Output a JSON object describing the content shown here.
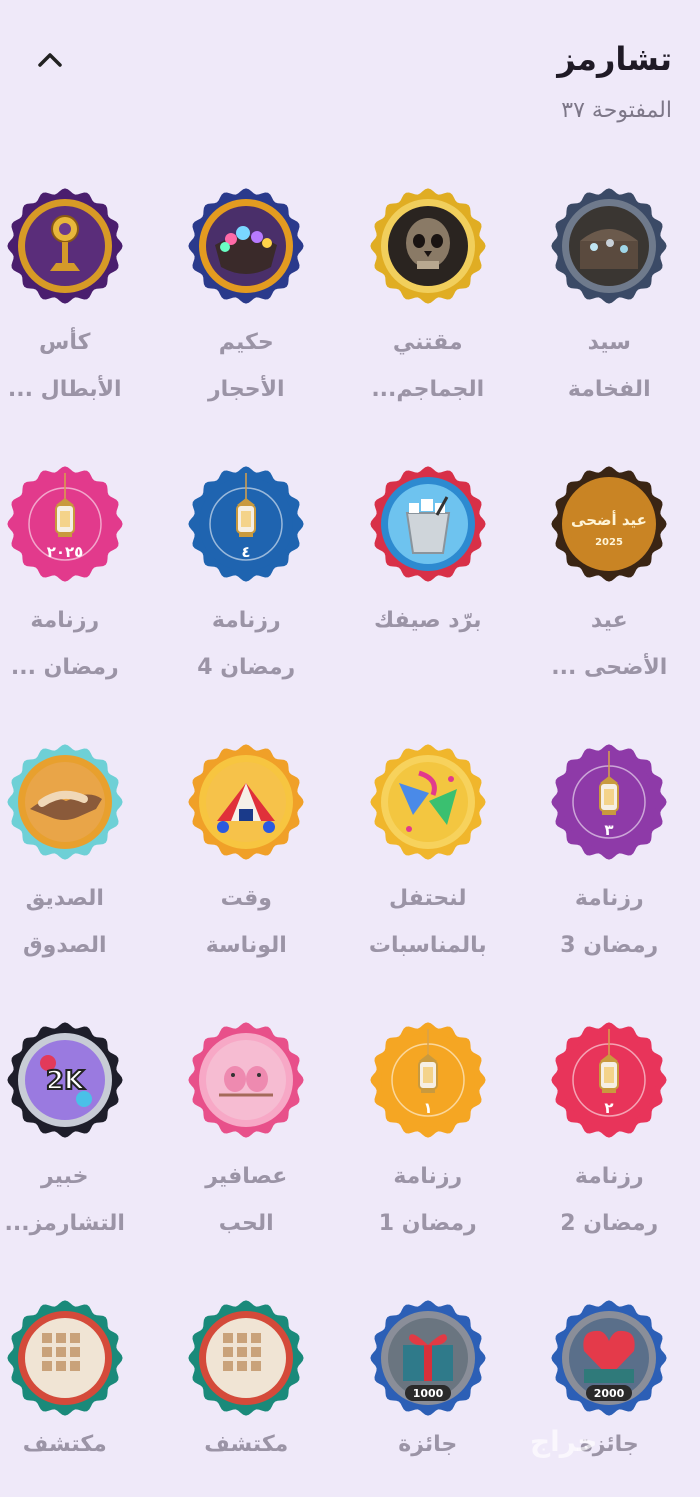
{
  "header": {
    "title": "تشارمز",
    "subtitle": "المفتوحة ٣٧"
  },
  "colors": {
    "background": "#efe9f9",
    "label": "#9b94a6",
    "title": "#1f1a26"
  },
  "badges": [
    {
      "line1": "سيد",
      "line2": "الفخامة",
      "rim": "#3b4a66",
      "inner": "#6f7a8c",
      "art": "treasure-chest-icon",
      "fill": "#3a3430"
    },
    {
      "line1": "مقتني",
      "line2": "الجماجم...",
      "rim": "#e0ad23",
      "inner": "#f1cf5c",
      "art": "skull-icon",
      "fill": "#2a2624"
    },
    {
      "line1": "حكيم",
      "line2": "الأحجار",
      "rim": "#2a3a8c",
      "inner": "#e39b20",
      "art": "gem-pot-icon",
      "fill": "#5a3b7a"
    },
    {
      "line1": "كأس",
      "line2": "الأبطال ...",
      "rim": "#4a1e6e",
      "inner": "#d79a26",
      "art": "trophy-icon",
      "fill": "#6a3a8c"
    },
    {
      "line1": "عيد",
      "line2": "الأضحى ...",
      "rim": "#3a2514",
      "inner": "#c98424",
      "art": "eid-text-icon",
      "fill": "#b87a22"
    },
    {
      "line1": "برّد صيفك",
      "line2": "",
      "rim": "#d83048",
      "inner": "#2d8ad0",
      "art": "ice-bucket-icon",
      "fill": "#5eb4e8"
    },
    {
      "line1": "رزنامة",
      "line2": "رمضان 4",
      "rim": "#1f64b0",
      "inner": "#1f64b0",
      "art": "lantern-icon",
      "fill": "#1f64b0",
      "num": "٤"
    },
    {
      "line1": "رزنامة",
      "line2": "رمضان ...",
      "rim": "#e23a8c",
      "inner": "#e23a8c",
      "art": "lantern-icon",
      "fill": "#e23a8c",
      "num": "٢٠٢٥"
    },
    {
      "line1": "رزنامة",
      "line2": "رمضان 3",
      "rim": "#8e3aa8",
      "inner": "#8e3aa8",
      "art": "lantern-icon",
      "fill": "#8e3aa8",
      "num": "٣"
    },
    {
      "line1": "لنحتفل",
      "line2": "بالمناسبات",
      "rim": "#f0b62c",
      "inner": "#f7d25c",
      "art": "party-icon",
      "fill": "#f3c640"
    },
    {
      "line1": "وقت",
      "line2": "الوناسة",
      "rim": "#f0a028",
      "inner": "#f7c540",
      "art": "circus-icon",
      "fill": "#f08a2a"
    },
    {
      "line1": "الصديق",
      "line2": "الصدوق",
      "rim": "#6ed0d6",
      "inner": "#e8a02e",
      "art": "handshake-icon",
      "fill": "#e9a548"
    },
    {
      "line1": "رزنامة",
      "line2": "رمضان 2",
      "rim": "#e8345a",
      "inner": "#e8345a",
      "art": "lantern-icon",
      "fill": "#e8345a",
      "num": "٢"
    },
    {
      "line1": "رزنامة",
      "line2": "رمضان 1",
      "rim": "#f5a623",
      "inner": "#f5a623",
      "art": "lantern-icon",
      "fill": "#f5a623",
      "num": "١"
    },
    {
      "line1": "عصافير",
      "line2": "الحب",
      "rim": "#e8508a",
      "inner": "#f7a8c6",
      "art": "lovebirds-icon",
      "fill": "#f6bcd2"
    },
    {
      "line1": "خبير",
      "line2": "التشارمز...",
      "rim": "#1e1e2a",
      "inner": "#c8ccd6",
      "art": "2k-icon",
      "fill": "#7a5ad0",
      "badge_text": "2K"
    },
    {
      "line1": "جائزة",
      "line2": "",
      "rim": "#2c5fb6",
      "inner": "#8a8e99",
      "art": "heart-gift-icon",
      "fill": "#3a6d8a",
      "badge_text": "2000"
    },
    {
      "line1": "جائزة",
      "line2": "",
      "rim": "#2c5fb6",
      "inner": "#8a8e99",
      "art": "gift-box-icon",
      "fill": "#2f6f8a",
      "badge_text": "1000"
    },
    {
      "line1": "مكتشف",
      "line2": "",
      "rim": "#1a8a7a",
      "inner": "#d44a3a",
      "art": "bingo-card-icon",
      "fill": "#e8dccc"
    },
    {
      "line1": "مكتشف",
      "line2": "",
      "rim": "#1a8a7a",
      "inner": "#d44a3a",
      "art": "bingo-card-icon",
      "fill": "#e8dccc"
    }
  ],
  "watermark": "حراج"
}
